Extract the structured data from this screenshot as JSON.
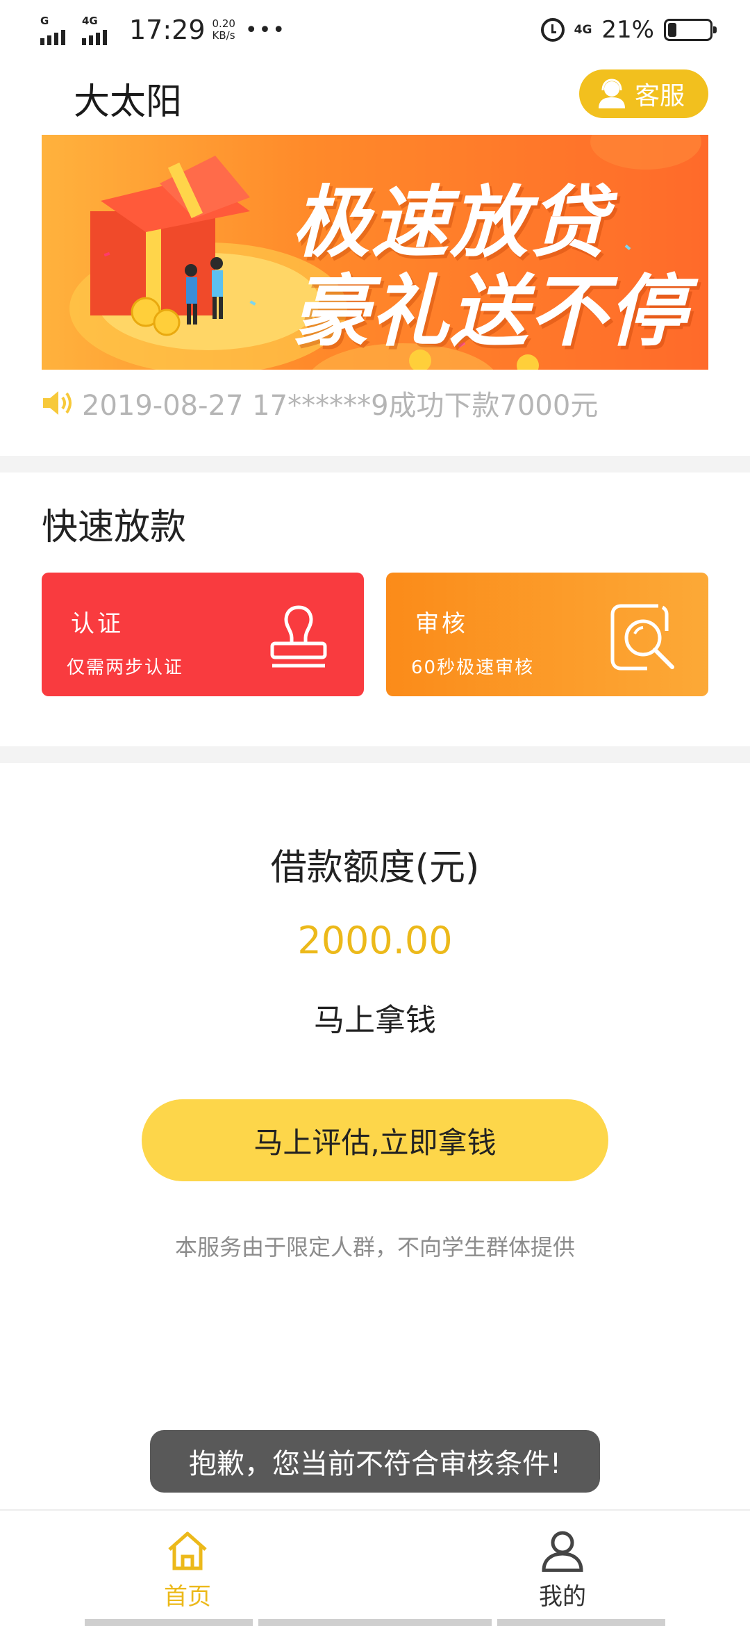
{
  "status_bar": {
    "sim1_type": "G",
    "sim2_type": "4G",
    "time": "17:29",
    "speed_value": "0.20",
    "speed_unit": "KB/s",
    "more": "•••",
    "net_type": "4G",
    "battery_percent": "21%",
    "battery_level": 0.21
  },
  "header": {
    "title": "大太阳",
    "customer_service_label": "客服"
  },
  "banner": {
    "line1": "极速放贷",
    "line2": "豪礼送不停"
  },
  "notice": {
    "text": "2019-08-27 17******9成功下款7000元"
  },
  "quick_section": {
    "title": "快速放款",
    "cards": [
      {
        "title": "认证",
        "subtitle": "仅需两步认证",
        "icon": "stamp-icon",
        "color": "#f93b3f"
      },
      {
        "title": "审核",
        "subtitle": "60秒极速审核",
        "icon": "magnifier-icon",
        "color": "#fb8b19"
      }
    ]
  },
  "loan": {
    "title": "借款额度(元)",
    "amount": "2000.00",
    "subtitle": "马上拿钱",
    "button_label": "马上评估,立即拿钱",
    "disclaimer": "本服务由于限定人群，不向学生群体提供"
  },
  "toast": {
    "text": "抱歉，您当前不符合审核条件!"
  },
  "bottom_nav": {
    "items": [
      {
        "label": "首页",
        "icon": "home-icon",
        "active": true
      },
      {
        "label": "我的",
        "icon": "user-icon",
        "active": false
      }
    ]
  },
  "colors": {
    "accent": "#ecb91a",
    "button_yellow": "#fdd64a",
    "red_card": "#f93b3f",
    "orange_card": "#fb8b19"
  }
}
